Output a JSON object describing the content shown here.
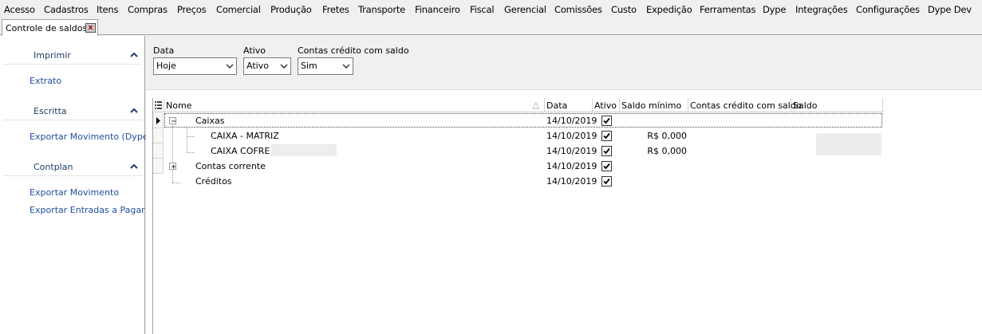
{
  "menu": [
    "Acesso",
    "Cadastros",
    "Itens",
    "Compras",
    "Preços",
    "Comercial",
    "Produção",
    "Fretes",
    "Transporte",
    "Financeiro",
    "Fiscal",
    "Gerencial",
    "Comissões",
    "Custo",
    "Expedição",
    "Ferramentas",
    "Dype",
    "Integrações",
    "Configurações",
    "Dype Dev"
  ],
  "tab": {
    "label": "Controle de saldos",
    "close_glyph": "x"
  },
  "sidebar": {
    "sections": [
      {
        "title": "Imprimir",
        "links": [
          "Extrato"
        ]
      },
      {
        "title": "Escritta",
        "links": [
          "Exportar Movimento (Dype)"
        ]
      },
      {
        "title": "Contplan",
        "links": [
          "Exportar Movimento",
          "Exportar Entradas a Pagar"
        ]
      }
    ]
  },
  "filters": {
    "data": {
      "label": "Data",
      "value": "Hoje"
    },
    "ativo": {
      "label": "Ativo",
      "value": "Ativo"
    },
    "contas": {
      "label": "Contas crédito com saldo",
      "value": "Sim"
    }
  },
  "grid": {
    "columns": [
      "Nome",
      "Data",
      "Ativo",
      "Saldo mínimo",
      "Contas crédito com saldo",
      "Saldo"
    ],
    "sort_glyph": "△",
    "rows": [
      {
        "nome": "Caixas",
        "data": "14/10/2019",
        "ativo": true,
        "saldo_minimo": ""
      },
      {
        "nome": "CAIXA - MATRIZ",
        "data": "14/10/2019",
        "ativo": true,
        "saldo_minimo": "R$ 0,000"
      },
      {
        "nome": "CAIXA COFRE -",
        "data": "14/10/2019",
        "ativo": true,
        "saldo_minimo": "R$ 0,000"
      },
      {
        "nome": "Contas corrente",
        "data": "14/10/2019",
        "ativo": true,
        "saldo_minimo": ""
      },
      {
        "nome": "Créditos",
        "data": "14/10/2019",
        "ativo": true,
        "saldo_minimo": ""
      }
    ]
  }
}
